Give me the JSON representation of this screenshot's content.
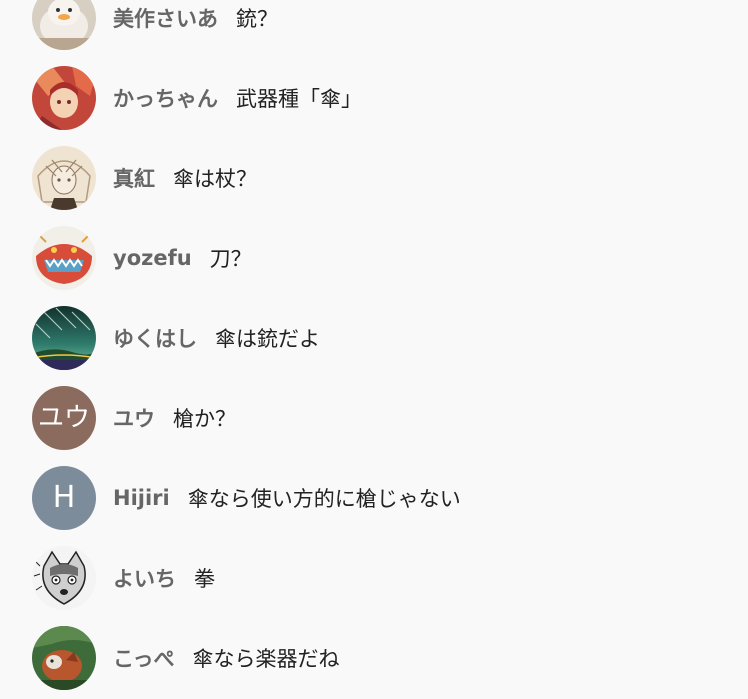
{
  "comments": [
    {
      "name": "美作さいあ",
      "text": "銃？",
      "avatar": {
        "kind": "image",
        "icon": "chick-plush-avatar",
        "colors": [
          "#e9e4dc",
          "#c9b9a6",
          "#f3a64a"
        ]
      }
    },
    {
      "name": "かっちゃん",
      "text": "武器種「傘」",
      "avatar": {
        "kind": "image",
        "icon": "anime-character-avatar",
        "colors": [
          "#c2463a",
          "#e98a5c",
          "#f4d3b5"
        ]
      }
    },
    {
      "name": "真紅",
      "text": "傘は杖？",
      "avatar": {
        "kind": "image",
        "icon": "sketch-character-avatar",
        "colors": [
          "#efe3d2",
          "#b49a7c",
          "#6b5a4a"
        ]
      }
    },
    {
      "name": "yozefu",
      "text": "刀？",
      "avatar": {
        "kind": "image",
        "icon": "monster-illustration-avatar",
        "colors": [
          "#f2eee8",
          "#d84c3a",
          "#5aa0c6"
        ]
      }
    },
    {
      "name": "ゆくはし",
      "text": "傘は銃だよ",
      "avatar": {
        "kind": "image",
        "icon": "meteor-landscape-avatar",
        "colors": [
          "#1d3a36",
          "#2f7c6d",
          "#7bc4a3"
        ]
      }
    },
    {
      "name": "ユウ",
      "text": "槍か？",
      "avatar": {
        "kind": "letter",
        "letter": "ユウ",
        "colors": [
          "#8b6b5d"
        ]
      }
    },
    {
      "name": "Hijiri",
      "text": "傘なら使い方的に槍じゃない",
      "avatar": {
        "kind": "letter",
        "letter": "H",
        "colors": [
          "#7d8c9a"
        ]
      }
    },
    {
      "name": "よいち",
      "text": "拳",
      "avatar": {
        "kind": "image",
        "icon": "manga-cat-avatar",
        "colors": [
          "#f4f4f4",
          "#9a9a9a",
          "#222222"
        ]
      }
    },
    {
      "name": "こっぺ",
      "text": "傘なら楽器だね",
      "avatar": {
        "kind": "image",
        "icon": "red-panda-avatar",
        "colors": [
          "#3d6b3a",
          "#b8562e",
          "#e9e2d6"
        ]
      }
    }
  ]
}
